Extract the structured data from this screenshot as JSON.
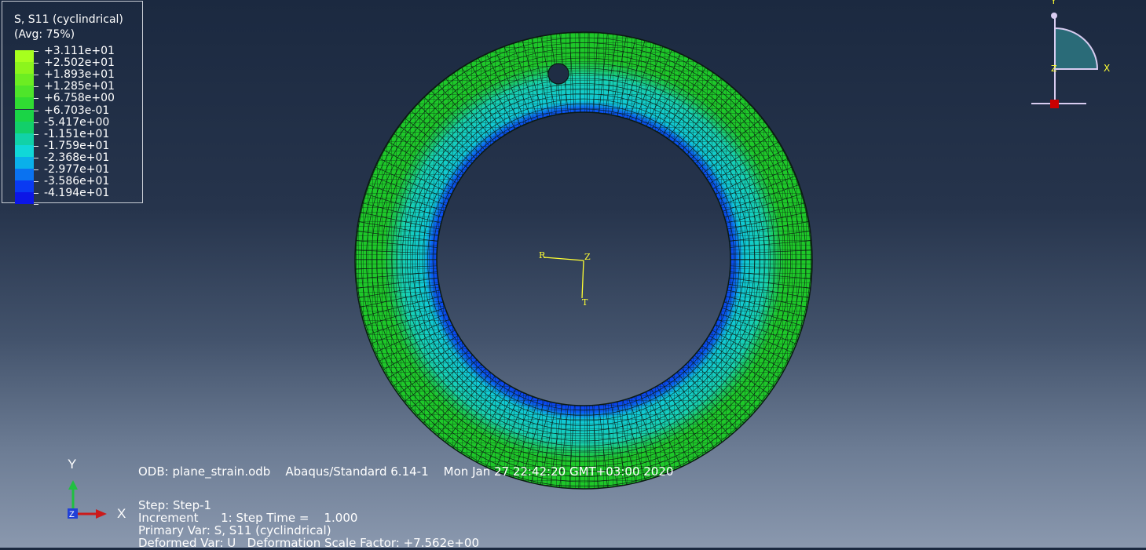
{
  "legend": {
    "title": "S, S11 (cyclindrical)",
    "subtitle": "(Avg: 75%)",
    "entries": [
      {
        "label": "+3.111e+01",
        "color": "#a7ff1e"
      },
      {
        "label": "+2.502e+01",
        "color": "#8cf51c"
      },
      {
        "label": "+1.893e+01",
        "color": "#6ced22"
      },
      {
        "label": "+1.285e+01",
        "color": "#4ee52a"
      },
      {
        "label": "+6.758e+00",
        "color": "#30dc32"
      },
      {
        "label": "+6.703e-01",
        "color": "#1ad446"
      },
      {
        "label": "-5.417e+00",
        "color": "#12cf6a"
      },
      {
        "label": "-1.151e+01",
        "color": "#11d2a8"
      },
      {
        "label": "-1.759e+01",
        "color": "#10d8d8"
      },
      {
        "label": "-2.368e+01",
        "color": "#0ab0ea"
      },
      {
        "label": "-2.977e+01",
        "color": "#0a72f0"
      },
      {
        "label": "-3.586e+01",
        "color": "#0a3af2"
      },
      {
        "label": "-4.194e+01",
        "color": "#0c16e6"
      }
    ]
  },
  "colors": {
    "outer_band": "#1ec829",
    "mid_band": "#18cfc0",
    "inner_band": "#0a2cf0",
    "hole": "#1c2a42",
    "mesh_line": "#0b1a12",
    "csys": "#ffff33",
    "triad_x": "#cc1a1a",
    "triad_y": "#20c040",
    "triad_z": "#2040d8",
    "view_cube": "#2a6b78"
  },
  "csys": {
    "r": "R",
    "z": "Z",
    "t": "T"
  },
  "triad": {
    "x": "X",
    "y": "Y",
    "z": "Z"
  },
  "view_cube": {
    "x": "X",
    "y": "Y",
    "z": "Z"
  },
  "info": {
    "odb_line": "ODB: plane_strain.odb    Abaqus/Standard 6.14-1    Mon Jan 27 22:42:20 GMT+03:00 2020",
    "step_line": "Step: Step-1",
    "increment_line": "Increment      1: Step Time =    1.000",
    "primary_line": "Primary Var: S, S11 (cyclindrical)",
    "deformed_line": "Deformed Var: U   Deformation Scale Factor: +7.562e+00"
  }
}
